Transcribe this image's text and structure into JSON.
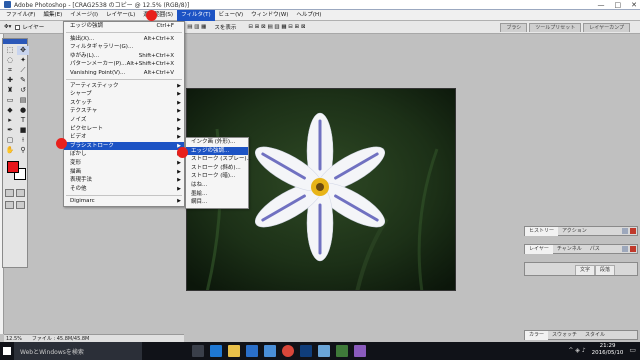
{
  "window": {
    "title": "Adobe Photoshop - [CRAG2538 のコピー @ 12.5% (RGB/8)]",
    "controls": [
      "—",
      "□",
      "✕"
    ]
  },
  "menubar": {
    "items": [
      "ファイル(F)",
      "編集(E)",
      "イメージ(I)",
      "レイヤー(L)",
      "選択範囲(S)",
      "フィルタ(T)",
      "ビュー(V)",
      "ウィンドウ(W)",
      "ヘルプ(H)"
    ]
  },
  "optionsbar": {
    "layer_checkbox": "レイヤー",
    "show_label": "スを表示"
  },
  "palette_well": {
    "tabs": [
      "ブラシ",
      "ツールプリセット",
      "レイヤーカンプ"
    ]
  },
  "filter_menu": {
    "items": [
      {
        "label": "エッジの強調",
        "shortcut": "Ctrl+F"
      },
      {
        "sep": true
      },
      {
        "label": "抽出(X)...",
        "shortcut": "Alt+Ctrl+X"
      },
      {
        "label": "フィルタギャラリー(G)...",
        "shortcut": ""
      },
      {
        "label": "ゆがみ(L)...",
        "shortcut": "Shift+Ctrl+X"
      },
      {
        "label": "パターンメーカー(P)...",
        "shortcut": "Alt+Shift+Ctrl+X"
      },
      {
        "label": "Vanishing Point(V)...",
        "shortcut": "Alt+Ctrl+V"
      },
      {
        "sep": true
      },
      {
        "label": "アーティスティック",
        "submenu": true
      },
      {
        "label": "シャープ",
        "submenu": true
      },
      {
        "label": "スケッチ",
        "submenu": true
      },
      {
        "label": "テクスチャ",
        "submenu": true
      },
      {
        "label": "ノイズ",
        "submenu": true
      },
      {
        "label": "ピクセレート",
        "submenu": true
      },
      {
        "label": "ビデオ",
        "submenu": true
      },
      {
        "label": "ブラシストローク",
        "submenu": true,
        "active": true
      },
      {
        "label": "ぼかし",
        "submenu": true
      },
      {
        "label": "変形",
        "submenu": true
      },
      {
        "label": "描画",
        "submenu": true
      },
      {
        "label": "表現手法",
        "submenu": true
      },
      {
        "label": "その他",
        "submenu": true
      },
      {
        "sep": true
      },
      {
        "label": "Digimarc",
        "submenu": true
      }
    ]
  },
  "brush_stroke_submenu": {
    "items": [
      {
        "label": "インク画 (外形)..."
      },
      {
        "label": "エッジの強調...",
        "active": true
      },
      {
        "label": "ストローク (スプレー)..."
      },
      {
        "label": "ストローク (斜め)..."
      },
      {
        "label": "ストローク (暗)..."
      },
      {
        "label": "はね..."
      },
      {
        "label": "墨絵..."
      },
      {
        "label": "網目..."
      }
    ]
  },
  "panels": {
    "history": [
      "ヒストリー",
      "アクション"
    ],
    "layers": [
      "レイヤー",
      "チャンネル",
      "パス"
    ],
    "character": [
      "文字",
      "段落"
    ],
    "color": [
      "カラー",
      "スウォッチ",
      "スタイル"
    ]
  },
  "status": {
    "zoom": "12.5%",
    "file_info": "ファイル : 45.8M/45.8M"
  },
  "taskbar": {
    "search_placeholder": "WebとWindowsを検索",
    "time": "21:29",
    "date": "2016/05/10"
  },
  "colors": {
    "accent": "#1c53c4",
    "foreground": "#e8151b",
    "background": "#ffffff",
    "marker": "#e8201c"
  }
}
